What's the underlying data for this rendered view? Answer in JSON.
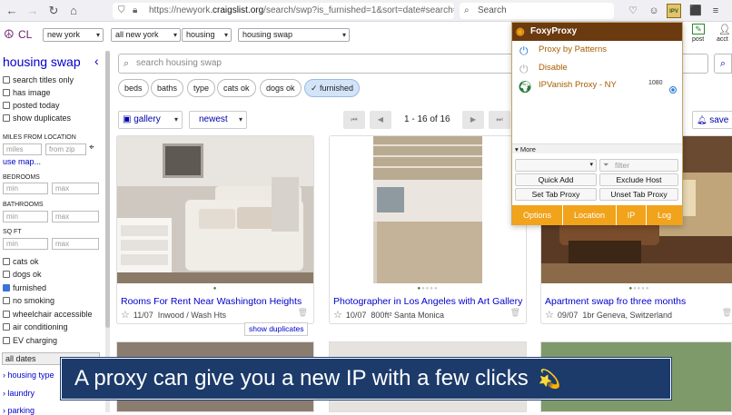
{
  "browser": {
    "url_prefix": "https://newyork.",
    "url_domain": "craigslist.org",
    "url_rest": "/search/swp?is_furnished=1&sort=date#search=1",
    "search_placeholder": "Search",
    "ext_badge": "IPV"
  },
  "header": {
    "logo": "CL",
    "selects": [
      "new york",
      "all new york",
      "housing",
      "housing swap"
    ],
    "post_label": "post",
    "account_label": "acct"
  },
  "sidebar": {
    "title": "housing swap",
    "checks": [
      {
        "label": "search titles only",
        "checked": false
      },
      {
        "label": "has image",
        "checked": false
      },
      {
        "label": "posted today",
        "checked": false
      },
      {
        "label": "show duplicates",
        "checked": false
      }
    ],
    "miles_label": "MILES FROM LOCATION",
    "miles_placeholder": "miles",
    "zip_placeholder": "from zip",
    "use_map": "use map...",
    "bedrooms_label": "BEDROOMS",
    "bathrooms_label": "BATHROOMS",
    "sqft_label": "SQ FT",
    "min_placeholder": "min",
    "max_placeholder": "max",
    "amenities": [
      {
        "label": "cats ok",
        "checked": false
      },
      {
        "label": "dogs ok",
        "checked": false
      },
      {
        "label": "furnished",
        "checked": true
      },
      {
        "label": "no smoking",
        "checked": false
      },
      {
        "label": "wheelchair accessible",
        "checked": false
      },
      {
        "label": "air conditioning",
        "checked": false
      },
      {
        "label": "EV charging",
        "checked": false
      }
    ],
    "dates_select": "all dates",
    "links": [
      "housing type",
      "laundry",
      "parking"
    ]
  },
  "main": {
    "search_placeholder": "search housing swap",
    "pills": [
      "beds",
      "baths",
      "type",
      "cats ok",
      "dogs ok",
      "✓ furnished"
    ],
    "view_label": "gallery",
    "sort_label": "newest",
    "page_range": "1 - 16 of 16",
    "save_label": "save",
    "show_duplicates": "show duplicates",
    "cards": [
      {
        "title": "Rooms For Rent Near Washington Heights",
        "date": "11/07",
        "details": "Inwood / Wash Hts"
      },
      {
        "title": "Photographer in Los Angeles with Art Gallery",
        "date": "10/07",
        "details": "800ft²  Santa Monica"
      },
      {
        "title": "Apartment swap fro three months",
        "date": "09/07",
        "details": "1br  Geneva, Switzerland"
      }
    ]
  },
  "foxyproxy": {
    "title": "FoxyProxy",
    "options": [
      "Proxy by Patterns",
      "Disable",
      "IPVanish Proxy - NY"
    ],
    "port": "1080",
    "more_label": "▾ More",
    "filter_placeholder": "filter",
    "buttons": [
      "Quick Add",
      "Exclude Host",
      "Set Tab Proxy",
      "Unset Tab Proxy"
    ],
    "footer": [
      "Options",
      "Location",
      "IP",
      "Log"
    ]
  },
  "banner": {
    "text": "A proxy can give you a new IP with a few clicks",
    "emoji": "💫"
  }
}
